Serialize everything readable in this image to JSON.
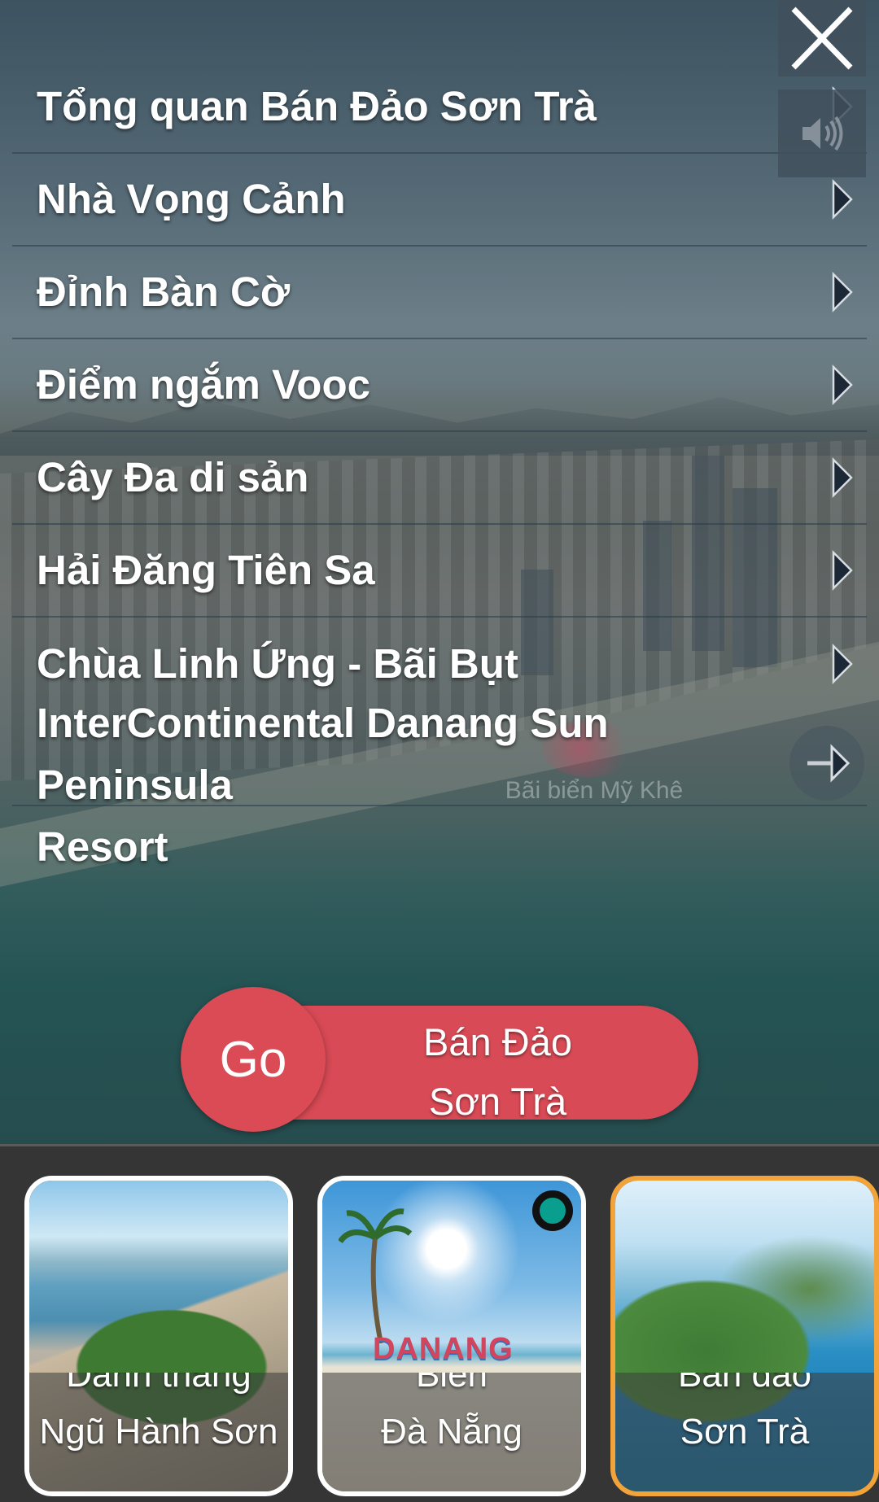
{
  "menu": {
    "items": [
      {
        "label": "Tổng quan Bán Đảo Sơn Trà"
      },
      {
        "label": "Nhà Vọng Cảnh"
      },
      {
        "label": "Đỉnh Bàn Cờ"
      },
      {
        "label": "Điểm ngắm Vooc"
      },
      {
        "label": "Cây Đa di sản"
      },
      {
        "label": "Hải Đăng Tiên Sa"
      },
      {
        "label": "Chùa Linh Ứng - Bãi Bụt"
      }
    ],
    "last_item": {
      "line1": "InterContinental Danang Sun Peninsula",
      "line2": "Resort"
    }
  },
  "watermark": "Bãi biển Mỹ Khê",
  "go_button": {
    "label": "Go",
    "destination_line1": "Bán Đảo",
    "destination_line2": "Sơn Trà"
  },
  "icons": {
    "close": "close-icon",
    "sound": "speaker-icon",
    "next": "arrow-right-icon"
  },
  "colors": {
    "go": "#da4b56",
    "active_card_border": "#f2a33a",
    "card_border": "#ffffff",
    "status_dot": "#0a9e8e"
  },
  "carousel": {
    "cards": [
      {
        "line1": "Danh thắng",
        "line2": "Ngũ Hành Sơn",
        "active": false
      },
      {
        "line1": "Biển",
        "line2": "Đà Nẵng",
        "active": false,
        "image_text": "DANANG"
      },
      {
        "line1": "Bán đảo",
        "line2": "Sơn Trà",
        "active": true
      }
    ]
  }
}
